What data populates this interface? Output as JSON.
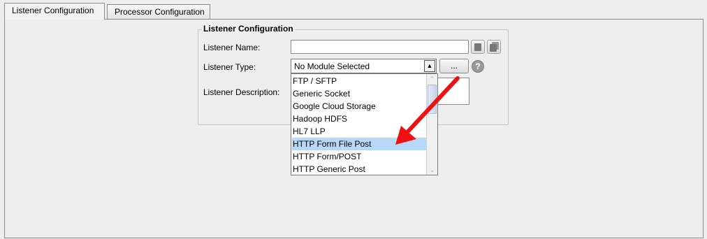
{
  "tabs": [
    "Listener Configuration",
    "Processor Configuration"
  ],
  "fieldset_title": "Listener Configuration",
  "labels": {
    "name": "Listener Name:",
    "type": "Listener Type:",
    "description": "Listener Description:"
  },
  "listener_name_value": "",
  "combo_value": "No Module Selected",
  "browse_button": "...",
  "help_glyph": "?",
  "dropdown_options": [
    "FTP / SFTP",
    "Generic Socket",
    "Google Cloud Storage",
    "Hadoop HDFS",
    "HL7 LLP",
    "HTTP Form File Post",
    "HTTP Form/POST",
    "HTTP Generic Post"
  ],
  "selected_option": "HTTP Form File Post",
  "colors": {
    "selection": "#b8d8f8",
    "annotation_arrow": "#ee1111"
  },
  "icons": [
    "copy-icon",
    "paste-icon",
    "help-icon",
    "dropdown-arrow-icon",
    "scroll-up-icon",
    "scroll-down-icon"
  ]
}
